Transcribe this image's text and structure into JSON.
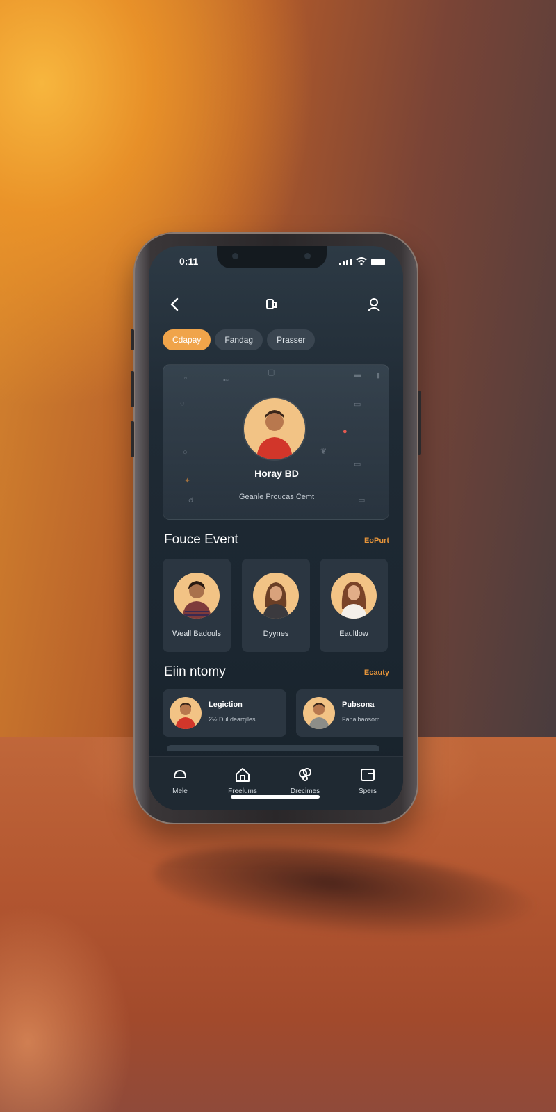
{
  "status_bar": {
    "time": "0:11"
  },
  "chips": [
    {
      "label": "Cdapay",
      "active": true
    },
    {
      "label": "Fandag",
      "active": false
    },
    {
      "label": "Prasser",
      "active": false
    }
  ],
  "profile": {
    "name": "Horay BD",
    "subtitle": "Geanle Proucas Cemt"
  },
  "section1": {
    "title": "Fouce Event",
    "link": "EoPurt",
    "people": [
      {
        "name": "Weall Badouls"
      },
      {
        "name": "Dyynes"
      },
      {
        "name": "Eaultlow"
      }
    ]
  },
  "section2": {
    "title": "Eiin ntomy",
    "link": "Ecauty",
    "items": [
      {
        "title": "Legiction",
        "subtitle": "2½ Dul dearqiles"
      },
      {
        "title": "Pubsona",
        "subtitle": "Fanalbaosom"
      }
    ]
  },
  "tabbar": [
    {
      "label": "Mele",
      "icon": "home-icon"
    },
    {
      "label": "Freelums",
      "icon": "house-icon"
    },
    {
      "label": "Drecimes",
      "icon": "link-icon"
    },
    {
      "label": "Spers",
      "icon": "square-icon"
    }
  ],
  "colors": {
    "accent": "#f0a44a",
    "card": "#2b3641",
    "screen": "#1f2a34"
  }
}
